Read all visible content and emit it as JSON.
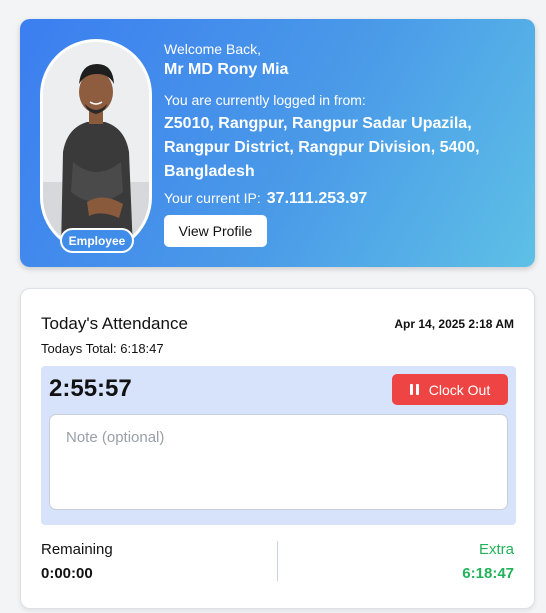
{
  "profile": {
    "welcome": "Welcome Back,",
    "name": "Mr MD Rony Mia",
    "login_label": "You are currently logged in from:",
    "location_lines": [
      "Z5010, Rangpur, Rangpur Sadar Upazila,",
      "Rangpur District, Rangpur Division, 5400,",
      "Bangladesh"
    ],
    "ip_label": "Your current IP:",
    "ip": "37.111.253.97",
    "role": "Employee",
    "view_profile_label": "View Profile",
    "avatar": "profile-photo"
  },
  "attendance": {
    "title": "Today's Attendance",
    "date": "Apr 14, 2025 2:18 AM",
    "todays_total": "Todays Total: 6:18:47",
    "elapsed": "2:55:57",
    "clock_out_label": "Clock Out",
    "clock_out_icon": "pause-icon",
    "note_placeholder": "Note (optional)",
    "note_value": "",
    "remaining_label": "Remaining",
    "remaining_value": "0:00:00",
    "extra_label": "Extra",
    "extra_value": "6:18:47"
  },
  "colors": {
    "accent_blue": "#3b7ef0",
    "clock_out_red": "#ef4444",
    "extra_green": "#22b35a",
    "timer_bg": "#d7e3fb"
  }
}
